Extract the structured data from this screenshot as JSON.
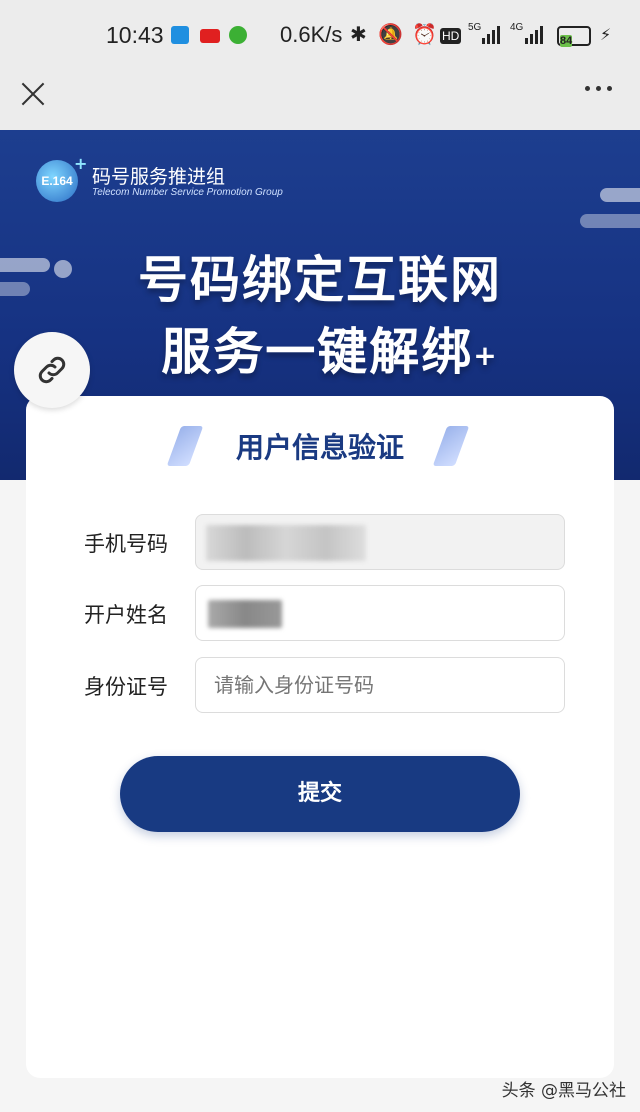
{
  "status_bar": {
    "time": "10:43",
    "net_speed": "0.6K/s",
    "net_5g": "5G",
    "net_4g": "4G",
    "hd": "HD",
    "battery": "84",
    "colors": {
      "battery_fill": "#6cc04a"
    }
  },
  "top_bar": {
    "close_icon": "close-icon",
    "more_icon": "more-icon"
  },
  "banner": {
    "logo_text": "E.164",
    "org_name_cn": "码号服务推进组",
    "org_name_en": "Telecom Number Service  Promotion Group",
    "headline_1": "号码绑定互联网",
    "headline_2": "服务一键解绑",
    "headline_2_suffix": "+"
  },
  "form": {
    "title": "用户信息验证",
    "phone_label": "手机号码",
    "name_label": "开户姓名",
    "id_label": "身份证号",
    "id_placeholder": "请输入身份证号码",
    "submit_label": "提交"
  },
  "watermark": "头条 @黑马公社",
  "colors": {
    "primary": "#183a82",
    "banner": "#1d3e8f",
    "title": "#1a3a82"
  }
}
